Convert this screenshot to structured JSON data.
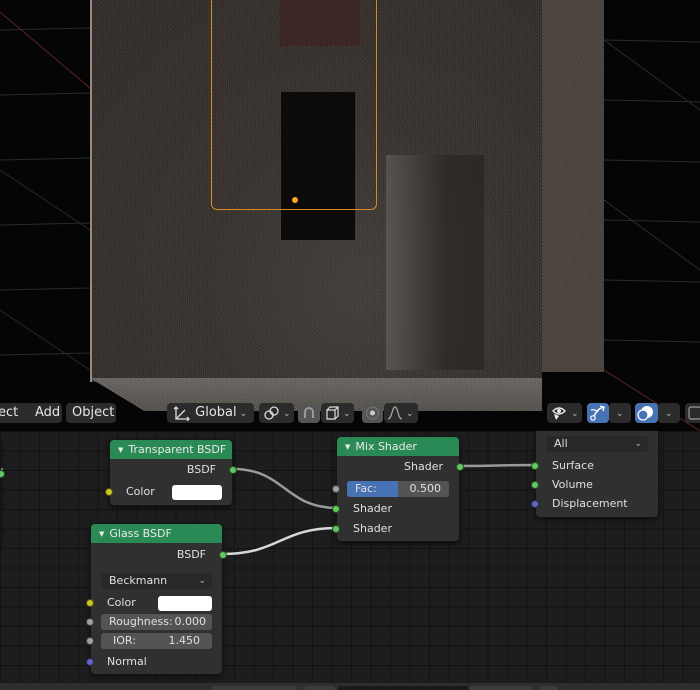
{
  "viewport": {
    "header": {
      "menu_items": [
        {
          "label": "ect"
        },
        {
          "label": "Add"
        },
        {
          "label": "Object"
        }
      ],
      "transform_orientation": {
        "icon": "transform-axes-icon",
        "label": "Global"
      },
      "pivot": {
        "icon": "pivot-link-icon"
      },
      "snap": {
        "icon": "magnet-snap-icon",
        "active": false
      },
      "snap_target": {
        "icon": "cube-snap-icon"
      },
      "proportional_edit": {
        "icon": "proportional-circle-icon"
      },
      "falloff": {
        "icon": "falloff-curve-icon"
      },
      "visibility": {
        "icon": "eye-selectable-icon"
      },
      "gizmo": {
        "icon": "gizmo-arrow-icon",
        "active": true
      },
      "overlays": {
        "icon": "overlays-icon",
        "active": true
      },
      "xray": {
        "icon": "xray-icon"
      }
    },
    "colors": {
      "selection_outline": "#d9892a",
      "origin": "#ffa31a"
    }
  },
  "node_editor": {
    "nodes": {
      "transparent_bsdf": {
        "title": "Transparent BSDF",
        "outputs": [
          {
            "label": "BSDF",
            "type": "shader"
          }
        ],
        "inputs": [
          {
            "label": "Color",
            "type": "color",
            "value": "#ffffff"
          }
        ]
      },
      "glass_bsdf": {
        "title": "Glass BSDF",
        "outputs": [
          {
            "label": "BSDF",
            "type": "shader"
          }
        ],
        "distribution": "Beckmann",
        "inputs": [
          {
            "label": "Color",
            "type": "color",
            "value": "#ffffff"
          },
          {
            "label": "Roughness:",
            "type": "value",
            "value": "0.000"
          },
          {
            "label": "IOR:",
            "type": "value",
            "value": "1.450"
          },
          {
            "label": "Normal",
            "type": "vector"
          }
        ]
      },
      "mix_shader": {
        "title": "Mix Shader",
        "outputs": [
          {
            "label": "Shader",
            "type": "shader"
          }
        ],
        "inputs": [
          {
            "label": "Fac:",
            "type": "value",
            "value": "0.500",
            "fraction": 0.5
          },
          {
            "label": "Shader",
            "type": "shader"
          },
          {
            "label": "Shader",
            "type": "shader"
          }
        ]
      },
      "material_output": {
        "target": "All",
        "inputs": [
          {
            "label": "Surface",
            "type": "shader"
          },
          {
            "label": "Volume",
            "type": "shader"
          },
          {
            "label": "Displacement",
            "type": "vector"
          }
        ]
      }
    },
    "colors": {
      "header": "#2a8a55",
      "socket_shader": "#63c763",
      "socket_color": "#c7c729",
      "socket_value": "#a1a1a1",
      "socket_vector": "#6363c7",
      "accent": "#4772b3"
    }
  }
}
